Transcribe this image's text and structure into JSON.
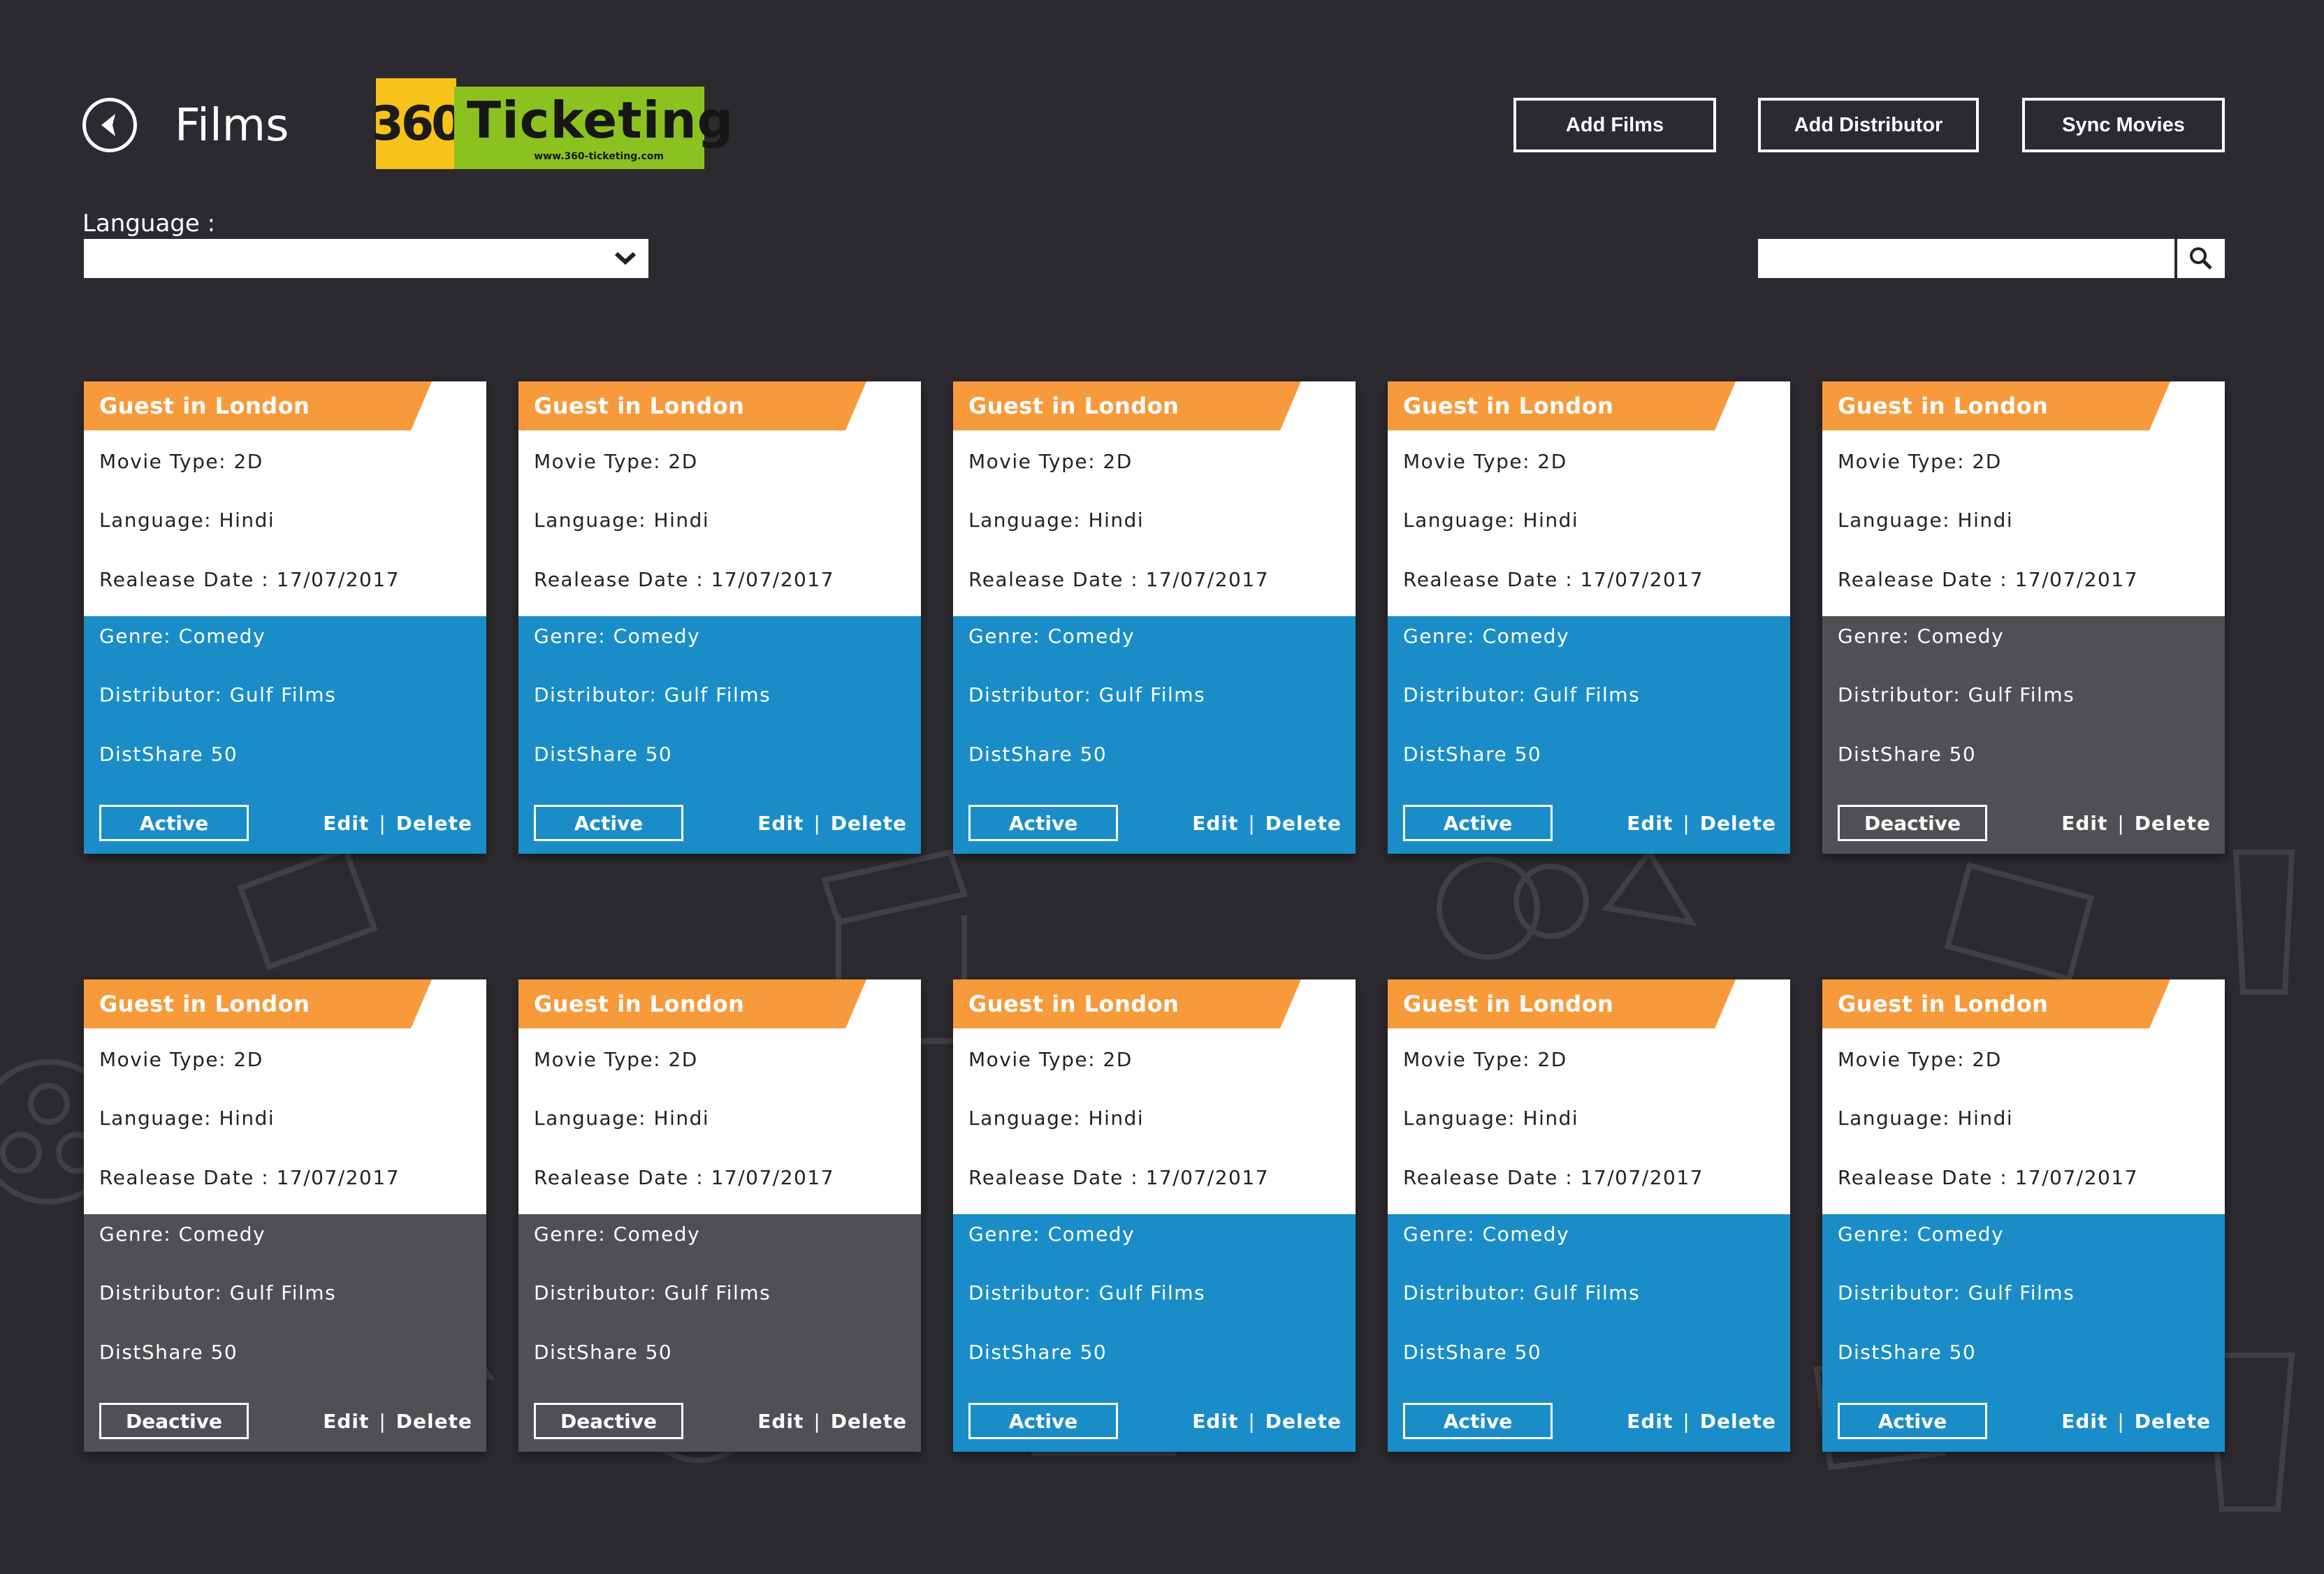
{
  "header": {
    "title": "Films",
    "logo_badge": "360",
    "logo_text": "Ticketing",
    "logo_url": "www.360-ticketing.com",
    "buttons": {
      "add_films": "Add Films",
      "add_distributor": "Add Distributor",
      "sync_movies": "Sync Movies"
    }
  },
  "filters": {
    "language_label": "Language :",
    "language_value": "",
    "search_value": ""
  },
  "colors": {
    "background": "#2d2a2f",
    "title_orange": "#f79a3b",
    "active_blue": "#1a8dc8",
    "deactive_gray": "#505054",
    "logo_green": "#8cc21f",
    "logo_yellow": "#f7c21a"
  },
  "icons": [
    "back-arrow-icon",
    "chevron-down-icon",
    "search-icon"
  ],
  "cards": [
    {
      "title": "Guest in London",
      "movie_type": "Movie Type: 2D",
      "language": "Language: Hindi",
      "release": "Realease Date : 17/07/2017",
      "genre": "Genre: Comedy",
      "distributor": "Distributor: Gulf Films",
      "distshare": "DistShare 50",
      "status": "Active",
      "edit": "Edit",
      "sep": "|",
      "delete": "Delete"
    },
    {
      "title": "Guest in London",
      "movie_type": "Movie Type: 2D",
      "language": "Language: Hindi",
      "release": "Realease Date : 17/07/2017",
      "genre": "Genre: Comedy",
      "distributor": "Distributor: Gulf Films",
      "distshare": "DistShare 50",
      "status": "Active",
      "edit": "Edit",
      "sep": "|",
      "delete": "Delete"
    },
    {
      "title": "Guest in London",
      "movie_type": "Movie Type: 2D",
      "language": "Language: Hindi",
      "release": "Realease Date : 17/07/2017",
      "genre": "Genre: Comedy",
      "distributor": "Distributor: Gulf Films",
      "distshare": "DistShare 50",
      "status": "Active",
      "edit": "Edit",
      "sep": "|",
      "delete": "Delete"
    },
    {
      "title": "Guest in London",
      "movie_type": "Movie Type: 2D",
      "language": "Language: Hindi",
      "release": "Realease Date : 17/07/2017",
      "genre": "Genre: Comedy",
      "distributor": "Distributor: Gulf Films",
      "distshare": "DistShare 50",
      "status": "Active",
      "edit": "Edit",
      "sep": "|",
      "delete": "Delete"
    },
    {
      "title": "Guest in London",
      "movie_type": "Movie Type: 2D",
      "language": "Language: Hindi",
      "release": "Realease Date : 17/07/2017",
      "genre": "Genre: Comedy",
      "distributor": "Distributor: Gulf Films",
      "distshare": "DistShare 50",
      "status": "Deactive",
      "edit": "Edit",
      "sep": "|",
      "delete": "Delete"
    },
    {
      "title": "Guest in London",
      "movie_type": "Movie Type: 2D",
      "language": "Language: Hindi",
      "release": "Realease Date : 17/07/2017",
      "genre": "Genre: Comedy",
      "distributor": "Distributor: Gulf Films",
      "distshare": "DistShare 50",
      "status": "Deactive",
      "edit": "Edit",
      "sep": "|",
      "delete": "Delete"
    },
    {
      "title": "Guest in London",
      "movie_type": "Movie Type: 2D",
      "language": "Language: Hindi",
      "release": "Realease Date : 17/07/2017",
      "genre": "Genre: Comedy",
      "distributor": "Distributor: Gulf Films",
      "distshare": "DistShare 50",
      "status": "Deactive",
      "edit": "Edit",
      "sep": "|",
      "delete": "Delete"
    },
    {
      "title": "Guest in London",
      "movie_type": "Movie Type: 2D",
      "language": "Language: Hindi",
      "release": "Realease Date : 17/07/2017",
      "genre": "Genre: Comedy",
      "distributor": "Distributor: Gulf Films",
      "distshare": "DistShare 50",
      "status": "Active",
      "edit": "Edit",
      "sep": "|",
      "delete": "Delete"
    },
    {
      "title": "Guest in London",
      "movie_type": "Movie Type: 2D",
      "language": "Language: Hindi",
      "release": "Realease Date : 17/07/2017",
      "genre": "Genre: Comedy",
      "distributor": "Distributor: Gulf Films",
      "distshare": "DistShare 50",
      "status": "Active",
      "edit": "Edit",
      "sep": "|",
      "delete": "Delete"
    },
    {
      "title": "Guest in London",
      "movie_type": "Movie Type: 2D",
      "language": "Language: Hindi",
      "release": "Realease Date : 17/07/2017",
      "genre": "Genre: Comedy",
      "distributor": "Distributor: Gulf Films",
      "distshare": "DistShare 50",
      "status": "Active",
      "edit": "Edit",
      "sep": "|",
      "delete": "Delete"
    }
  ]
}
